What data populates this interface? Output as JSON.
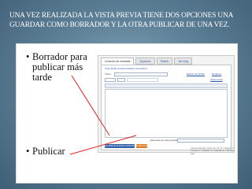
{
  "slide": {
    "title": "Una vez realizada la vista previa tiene dos opciones una guardar como borrador y la otra publicar de una vez.",
    "bullets": [
      {
        "marker": "•",
        "text": "Borrador para publicar más tarde"
      },
      {
        "marker": "•",
        "text": "Publicar"
      }
    ],
    "colors": {
      "background": "#4c6f87",
      "content_bg": "#ffffff",
      "arrow": "#e02020"
    }
  },
  "screenshot": {
    "tabs": [
      {
        "label": "Creación de entradas",
        "active": true
      },
      {
        "label": "Opciones",
        "active": false
      },
      {
        "label": "Diseño",
        "active": false
      },
      {
        "label": "Ver blog",
        "active": false
      }
    ],
    "top_links": "Crear   Editar entradas   Moderar comentarios",
    "title_label": "Título:",
    "html_link": "Edición de HTML",
    "preview_link": "Redactar",
    "hide_preview_link": "Vista previa",
    "tags_label": "Etiquetas de esta entrada:",
    "save_button": "GUARDAR AHORA COMO BORRADOR",
    "publish_button": "PUBLICAR",
    "side_note": "Accesos directos: pulsa Ctrl con: B = Negrita, I = Cursiva, P = Publicar, S = Guardar, D = Borrador más"
  }
}
